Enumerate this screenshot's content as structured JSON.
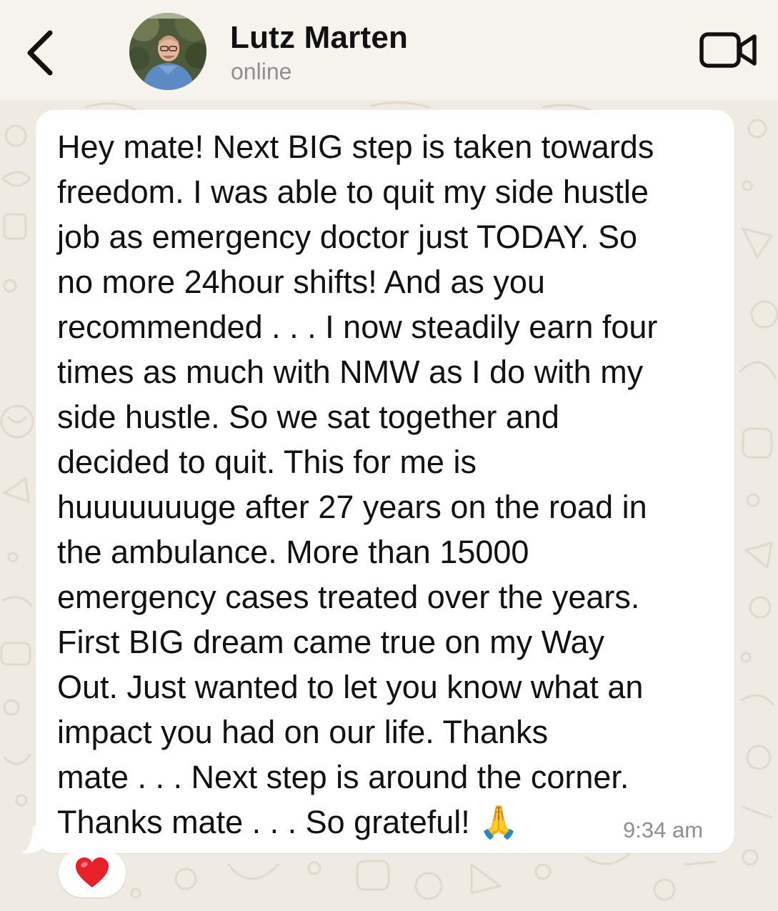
{
  "header": {
    "back_icon": "chevron-left-icon",
    "contact_name": "Lutz Marten",
    "status": "online",
    "video_icon": "video-camera-icon"
  },
  "message": {
    "text": "Hey mate! Next BIG step is taken towards\nfreedom. I was able to quit my side hustle\njob as emergency doctor just TODAY. So\nno more 24hour shifts! And as you\nrecommended . . . I now steadily earn four\ntimes as much with NMW as I do with my\nside hustle. So we sat together and\ndecided to quit. This for me is\nhuuuuuuuge after 27 years on the road in\nthe ambulance. More than 15000\nemergency cases treated over the years.\nFirst BIG dream came true on my Way\nOut. Just wanted to let you know what an\nimpact you had on our life. Thanks\nmate . . . Next step is around the corner.\nThanks mate . . . So grateful! ",
    "emoji": "🙏",
    "timestamp": "9:34 am",
    "reaction": "❤️"
  },
  "colors": {
    "background": "#efeae2",
    "bubble": "#ffffff",
    "text": "#111111",
    "muted": "#8e8e93",
    "pattern": "#e3dbcd"
  }
}
